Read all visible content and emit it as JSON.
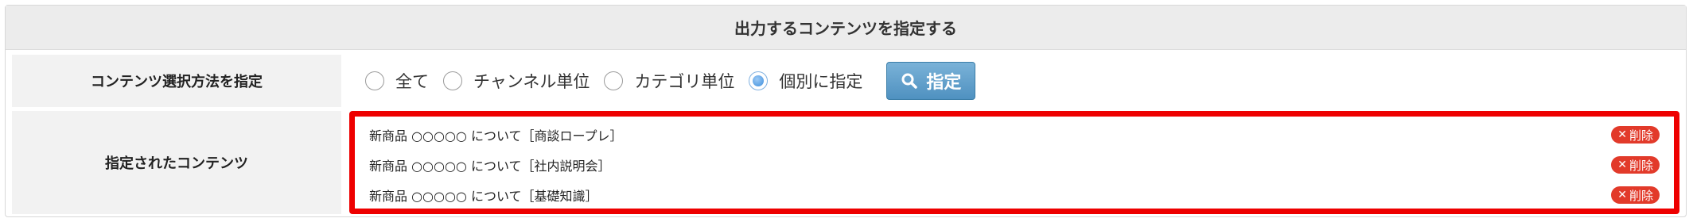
{
  "header": {
    "title": "出力するコンテンツを指定する"
  },
  "method_row": {
    "label": "コンテンツ選択方法を指定",
    "options": [
      {
        "label": "全て",
        "checked": false
      },
      {
        "label": "チャンネル単位",
        "checked": false
      },
      {
        "label": "カテゴリ単位",
        "checked": false
      },
      {
        "label": "個別に指定",
        "checked": true
      }
    ],
    "button_label": "指定",
    "button_icon": "search-icon"
  },
  "selected_row": {
    "label": "指定されたコンテンツ",
    "items": [
      {
        "title": "新商品 ○○○○○ について［商談ロープレ］",
        "delete_label": "削除"
      },
      {
        "title": "新商品 ○○○○○ について［社内説明会］",
        "delete_label": "削除"
      },
      {
        "title": "新商品 ○○○○○ について［基礎知識］",
        "delete_label": "削除"
      }
    ],
    "highlight_color": "#ee0000"
  }
}
